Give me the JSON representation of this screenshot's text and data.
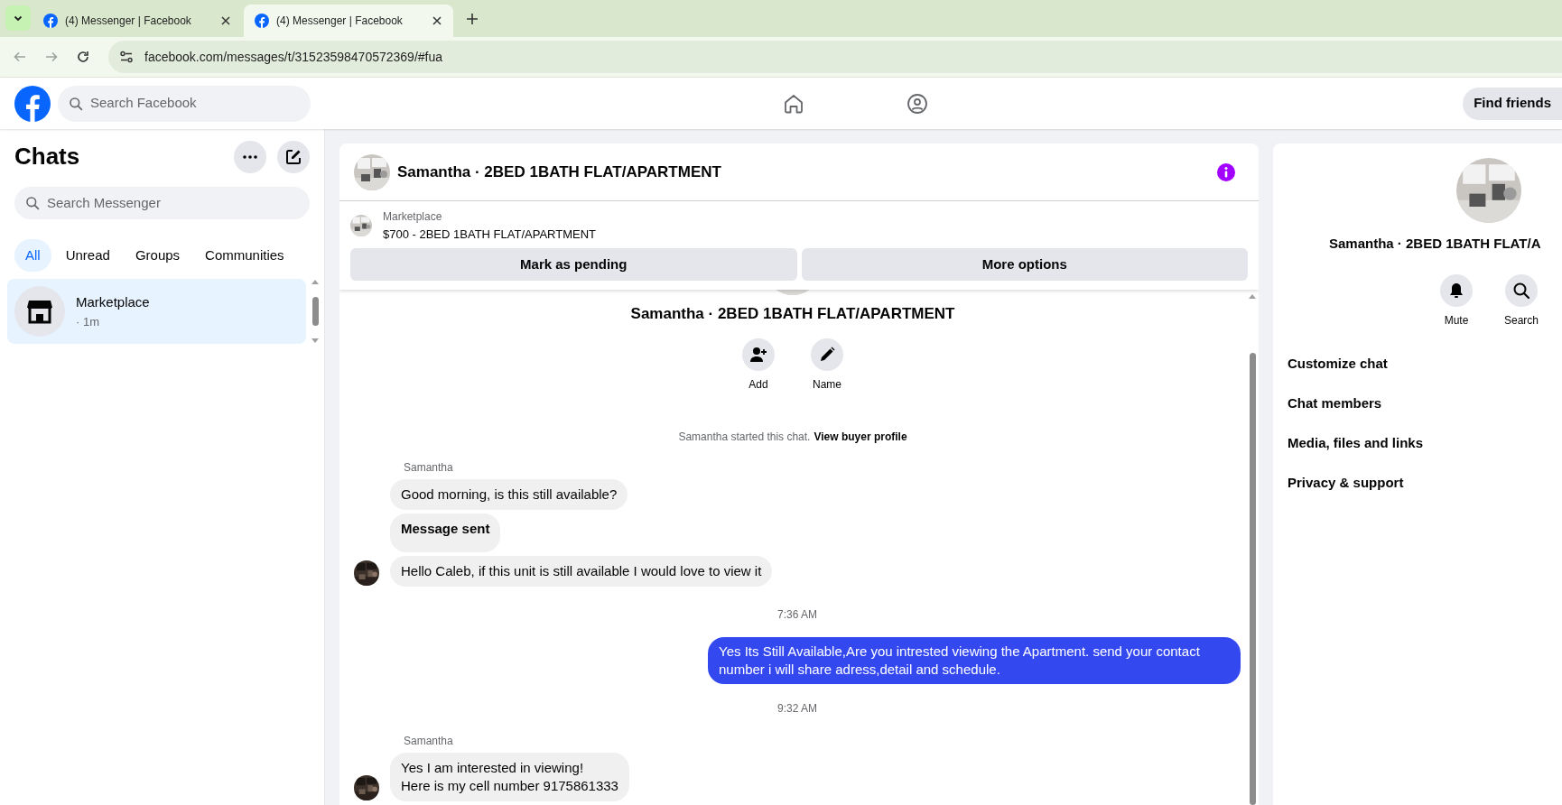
{
  "browser": {
    "tabs": [
      {
        "title": "(4) Messenger | Facebook",
        "selected": false
      },
      {
        "title": "(4) Messenger | Facebook",
        "selected": true
      }
    ],
    "url": "facebook.com/messages/t/31523598470572369/#fua"
  },
  "header": {
    "search_placeholder": "Search Facebook",
    "find_friends": "Find friends"
  },
  "sidebar": {
    "title": "Chats",
    "search_placeholder": "Search Messenger",
    "filters": [
      {
        "label": "All",
        "selected": true
      },
      {
        "label": "Unread",
        "selected": false
      },
      {
        "label": "Groups",
        "selected": false
      },
      {
        "label": "Communities",
        "selected": false
      }
    ],
    "chats": [
      {
        "name": "Marketplace",
        "meta": "· 1m",
        "selected": true
      }
    ]
  },
  "chat": {
    "title": "Samantha · 2BED 1BATH FLAT/APARTMENT",
    "listing": {
      "label": "Marketplace",
      "title": "$700 - 2BED 1BATH FLAT/APARTMENT"
    },
    "actions": [
      "Mark as pending",
      "More options"
    ],
    "intro": {
      "name": "Samantha · 2BED 1BATH FLAT/APARTMENT",
      "actions": [
        "Add",
        "Name"
      ],
      "notice": "Samantha started this chat.",
      "link": "View buyer profile"
    },
    "messages": [
      {
        "kind": "sender",
        "text": "Samantha"
      },
      {
        "kind": "received",
        "text": "Good morning, is this still available?",
        "bold": false,
        "avatar": false
      },
      {
        "kind": "received",
        "text": "Message sent",
        "bold": true,
        "avatar": false
      },
      {
        "kind": "received",
        "text": "Hello Caleb, if this unit is still available I would love to view it",
        "bold": false,
        "avatar": true
      },
      {
        "kind": "time",
        "text": "7:36 AM"
      },
      {
        "kind": "sent",
        "text": "Yes Its Still Available,Are you intrested viewing the Apartment. send your contact number i will share adress,detail and schedule."
      },
      {
        "kind": "time",
        "text": "9:32 AM"
      },
      {
        "kind": "sender",
        "text": "Samantha"
      },
      {
        "kind": "received",
        "text": "Yes I am interested in viewing!\nHere is my cell number 9175861333",
        "bold": false,
        "avatar": true
      }
    ]
  },
  "details": {
    "name": "Samantha · 2BED 1BATH FLAT/A",
    "actions": [
      "Mute",
      "Search"
    ],
    "menu": [
      "Customize chat",
      "Chat members",
      "Media, files and links",
      "Privacy & support"
    ]
  }
}
